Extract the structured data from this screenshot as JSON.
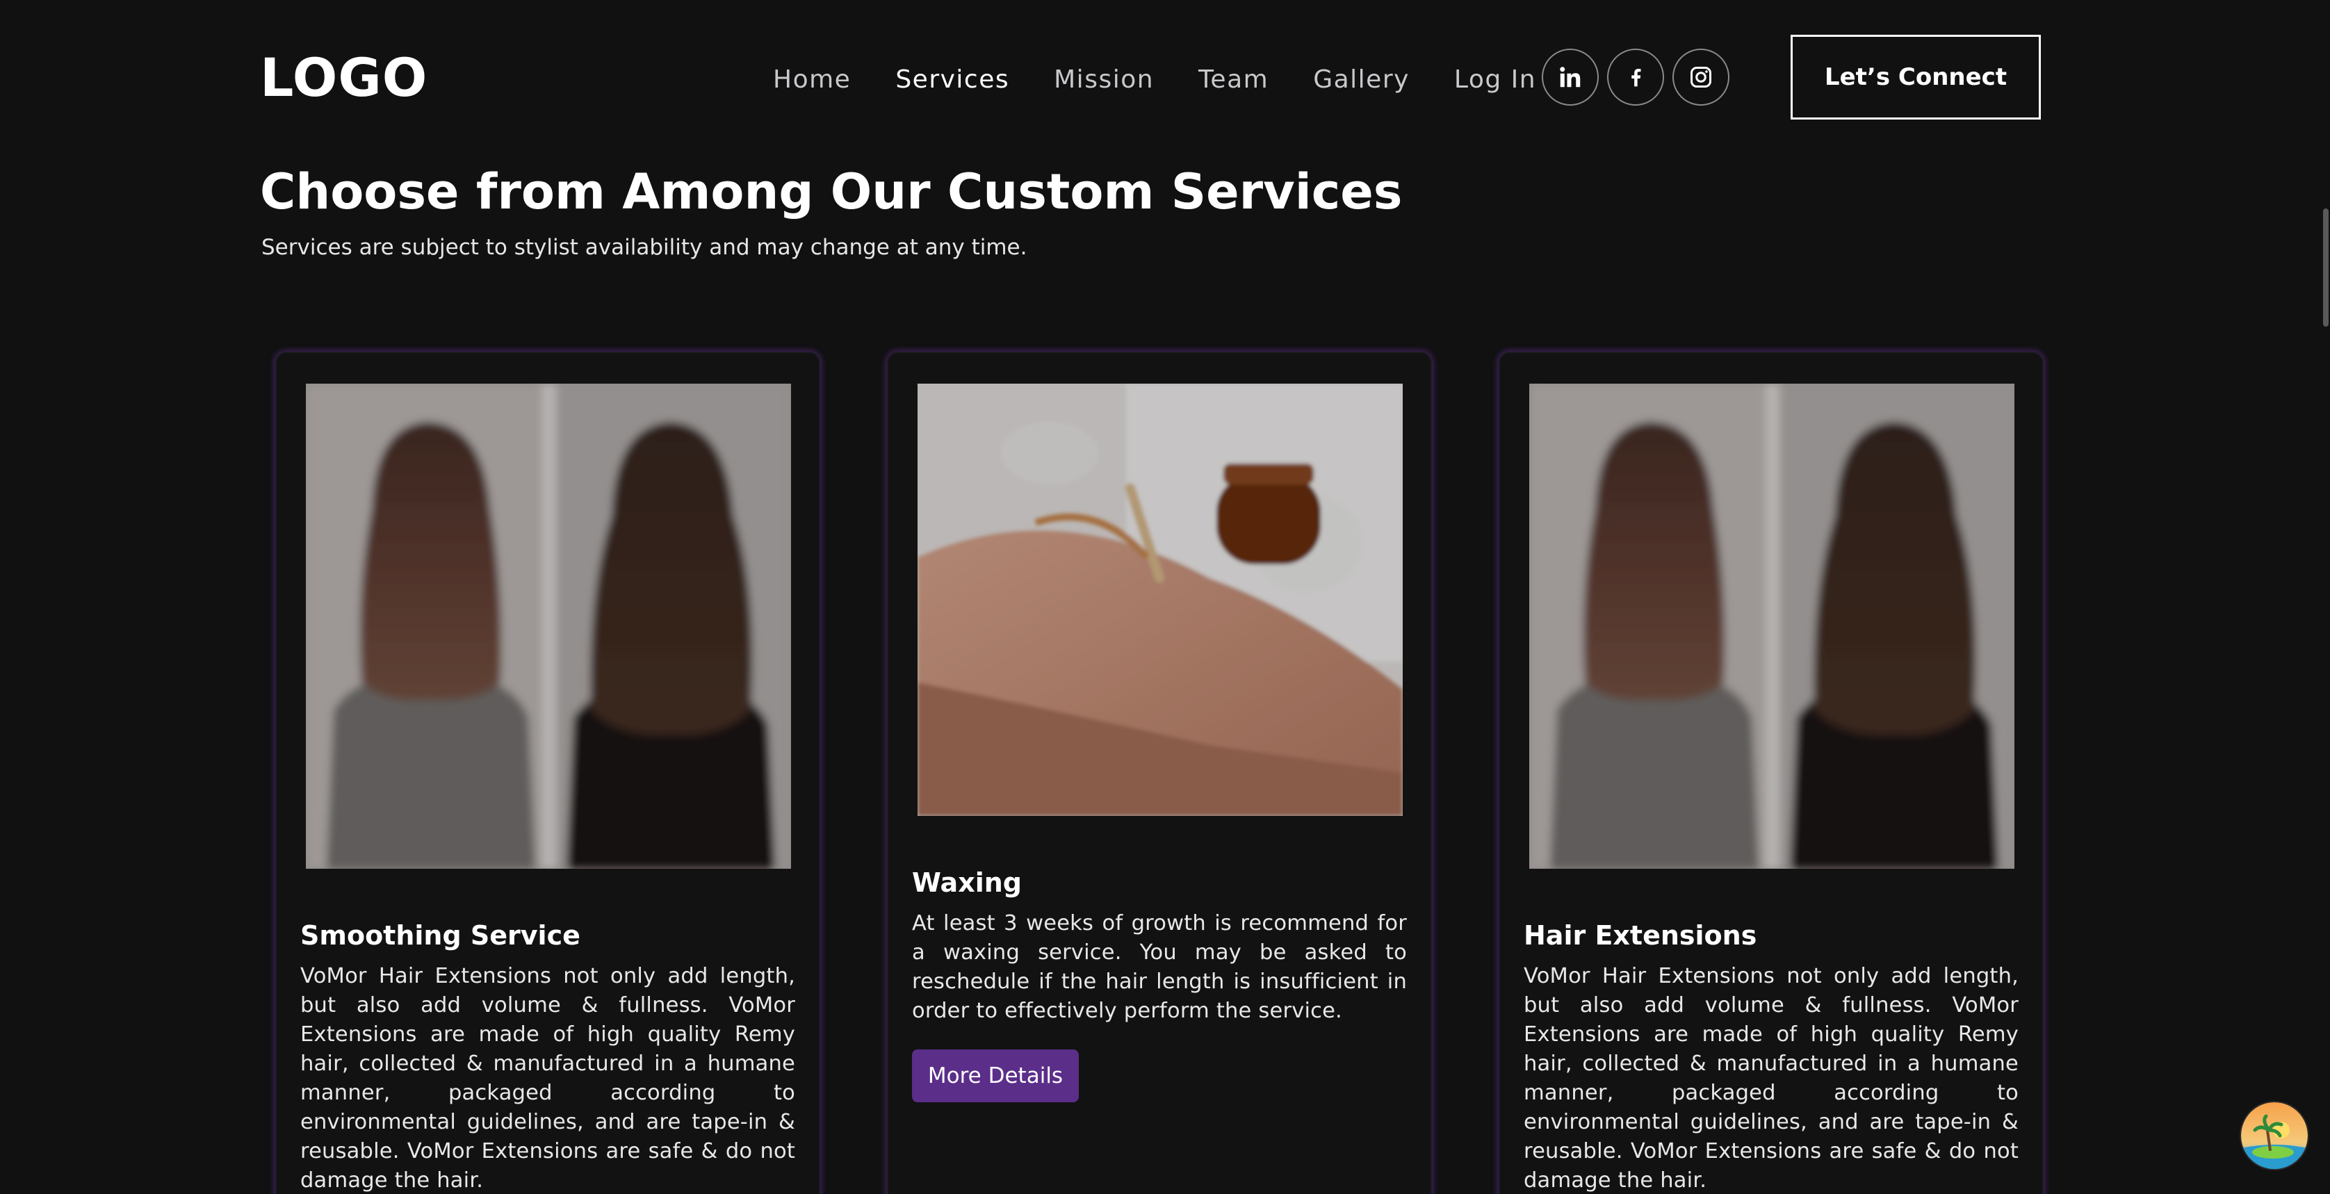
{
  "header": {
    "logo": "LOGO",
    "nav": [
      {
        "label": "Home",
        "active": false
      },
      {
        "label": "Services",
        "active": true
      },
      {
        "label": "Mission",
        "active": false
      },
      {
        "label": "Team",
        "active": false
      },
      {
        "label": "Gallery",
        "active": false
      },
      {
        "label": "Log In",
        "active": false
      }
    ],
    "socials": [
      {
        "icon": "linkedin-icon"
      },
      {
        "icon": "facebook-icon"
      },
      {
        "icon": "instagram-icon"
      }
    ],
    "cta_label": "Let’s Connect"
  },
  "main": {
    "title": "Choose from Among Our Custom Services",
    "subtitle": "Services are subject to stylist availability and may change at any time."
  },
  "services": [
    {
      "title": "Smoothing Service",
      "image": "hair-before-after",
      "text": "VoMor Hair Extensions not only add length, but also add volume & fullness. VoMor Extensions are made of high quality Remy hair, collected & manufactured in a humane manner, packaged according to environmental guidelines, and are tape-in & reusable. VoMor Extensions are safe & do not damage the hair."
    },
    {
      "title": "Waxing",
      "image": "leg-waxing",
      "text": "At least 3 weeks of growth is recommend for a waxing service. You may be asked to reschedule if the hair length is insufficient in order to effectively perform the service.",
      "button": "More Details"
    },
    {
      "title": "Hair Extensions",
      "image": "hair-before-after",
      "text": "VoMor Hair Extensions not only add length, but also add volume & fullness. VoMor Extensions are made of high quality Remy hair, collected & manufactured in a humane manner, packaged according to environmental guidelines, and are tape-in & reusable. VoMor Extensions are safe & do not damage the hair."
    }
  ],
  "colors": {
    "background": "#111112",
    "accent": "#5b2e8a",
    "card_glow": "#6e32a0"
  }
}
